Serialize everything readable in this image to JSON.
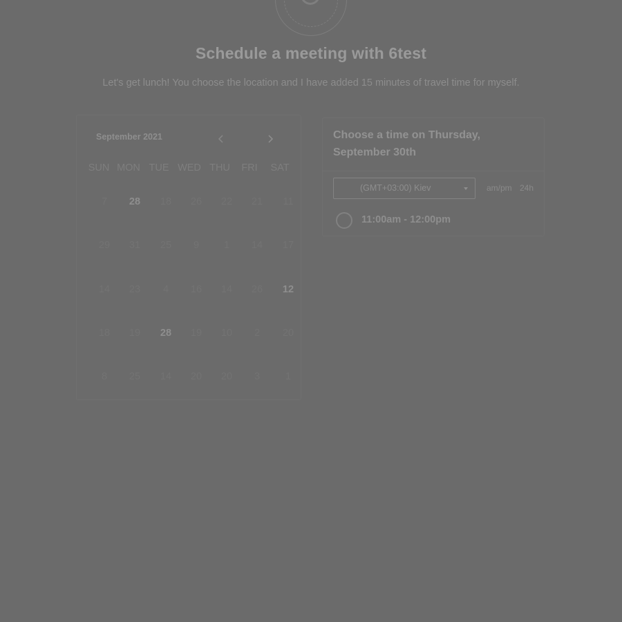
{
  "header": {
    "title": "Schedule a meeting with 6test",
    "subtitle": "Let's get lunch! You choose the location and I have added 15 minutes of travel time for myself."
  },
  "calendar": {
    "month": "September 2021",
    "prev_icon": "chevron-left-icon",
    "next_icon": "chevron-right-icon",
    "weekdays": [
      "SUN",
      "MON",
      "TUE",
      "WED",
      "THU",
      "FRI",
      "SAT"
    ],
    "weeks": [
      [
        "7",
        "28",
        "18",
        "26",
        "22",
        "21",
        "11"
      ],
      [
        "29",
        "31",
        "25",
        "9",
        "1",
        "14",
        "17"
      ],
      [
        "14",
        "23",
        "4",
        "16",
        "14",
        "26",
        "12"
      ],
      [
        "18",
        "19",
        "28",
        "19",
        "10",
        "2",
        "20"
      ],
      [
        "8",
        "25",
        "14",
        "20",
        "20",
        "3",
        "1"
      ]
    ]
  },
  "time_panel": {
    "heading": "Choose a time on Thursday, September 30th",
    "timezone": "(GMT+03:00) Kiev",
    "format_12h": "am/pm",
    "format_24h": "24h",
    "slots": [
      "11:00am - 12:00pm"
    ]
  },
  "colors": {
    "overlay": "#6b6b6b"
  }
}
